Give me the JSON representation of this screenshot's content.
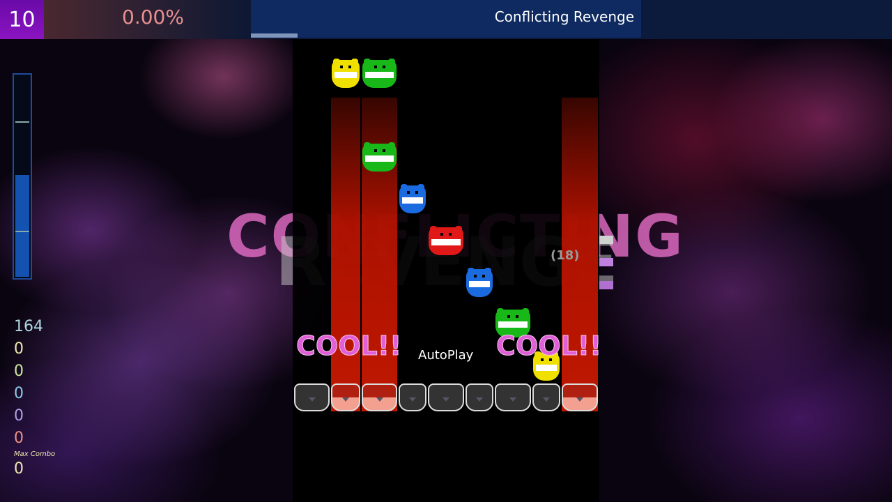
{
  "header": {
    "level": "10",
    "percent": "0.00%",
    "song_title": "Conflicting Revenge",
    "progress": 0.12
  },
  "background_title": {
    "line1": "CONFLICTING",
    "line2": "REVENGE"
  },
  "hp_gauge": {
    "level": 0.5
  },
  "playfield": {
    "judgement_left": "COOL!!",
    "judgement_right": "COOL!!",
    "autoplay": "AutoPlay",
    "combo": "(18)",
    "lanes": 9,
    "pressed_lanes": [
      1,
      2,
      8
    ],
    "notes": [
      {
        "lane": 1,
        "color": "#f0e000"
      },
      {
        "lane": 2,
        "color": "#18b818"
      },
      {
        "lane": 2,
        "color": "#18b818"
      },
      {
        "lane": 3,
        "color": "#1a6ae0"
      },
      {
        "lane": 4,
        "color": "#e01818"
      },
      {
        "lane": 5,
        "color": "#1a6ae0"
      },
      {
        "lane": 6,
        "color": "#18b818"
      },
      {
        "lane": 7,
        "color": "#f0e000"
      }
    ]
  },
  "stats": {
    "values": [
      {
        "v": "164",
        "color": "#b0d8e0"
      },
      {
        "v": "0",
        "color": "#f0e8b0"
      },
      {
        "v": "0",
        "color": "#d0e8a0"
      },
      {
        "v": "0",
        "color": "#90c8e8"
      },
      {
        "v": "0",
        "color": "#b0a0e8"
      },
      {
        "v": "0",
        "color": "#f09080"
      }
    ],
    "max_combo_label": "Max Combo",
    "max_combo": "0"
  }
}
